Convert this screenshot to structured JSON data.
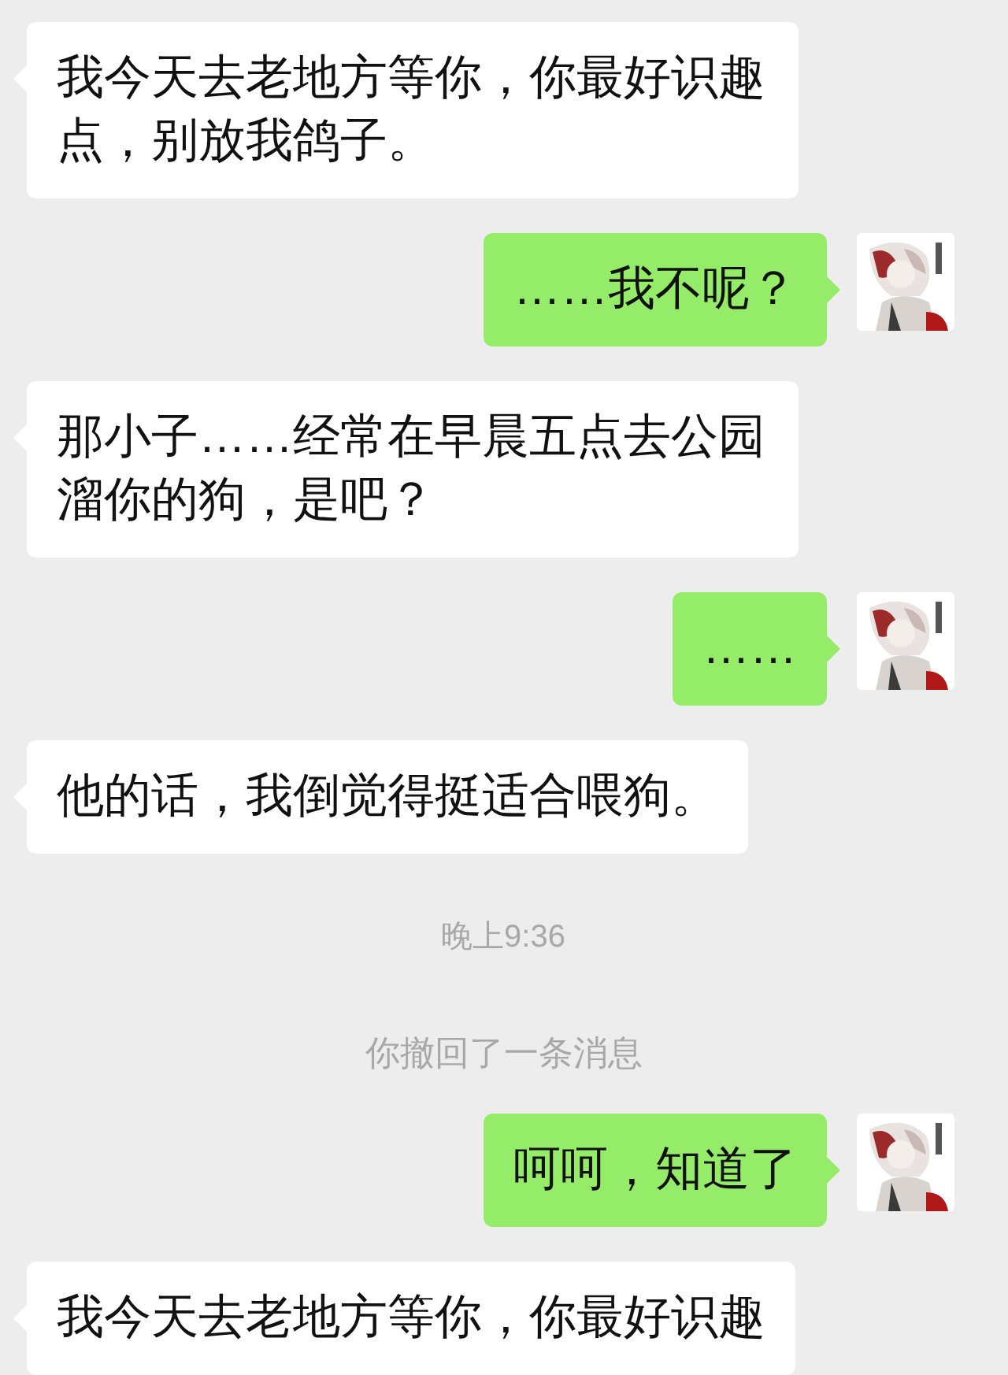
{
  "messages": [
    {
      "kind": "incoming",
      "text": "我今天去老地方等你，你最好识趣点，别放我鸽子。"
    },
    {
      "kind": "outgoing",
      "text": "……我不呢？"
    },
    {
      "kind": "incoming",
      "text": "那小子……经常在早晨五点去公园溜你的狗，是吧？"
    },
    {
      "kind": "outgoing",
      "text": "……"
    },
    {
      "kind": "incoming",
      "text": "他的话，我倒觉得挺适合喂狗。"
    },
    {
      "kind": "time",
      "text": "晚上9:36"
    },
    {
      "kind": "system",
      "text": "你撤回了一条消息"
    },
    {
      "kind": "outgoing",
      "text": "呵呵，知道了"
    },
    {
      "kind": "incoming",
      "text": "我今天去老地方等你，你最好识趣"
    }
  ]
}
